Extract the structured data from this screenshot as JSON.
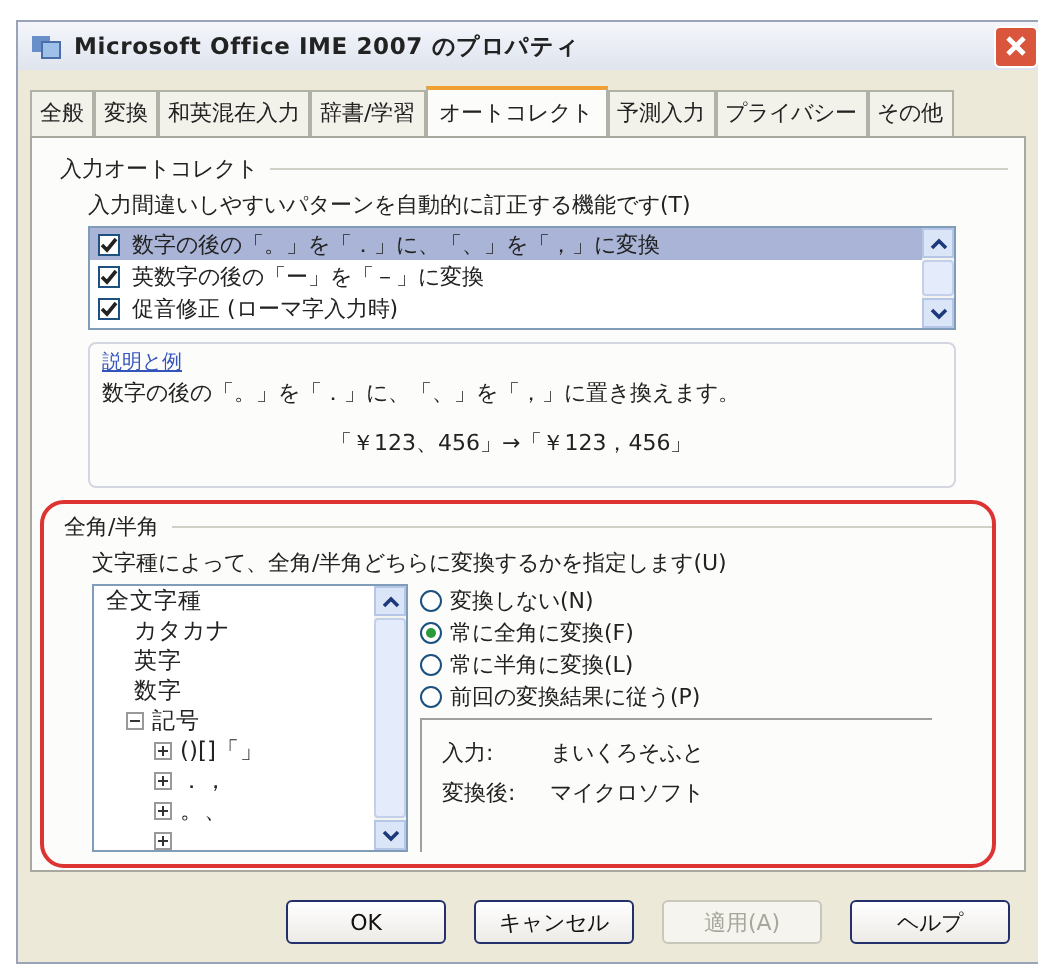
{
  "window": {
    "title": "Microsoft Office IME 2007 のプロパティ"
  },
  "tabs": [
    {
      "label": "全般",
      "selected": false
    },
    {
      "label": "変換",
      "selected": false
    },
    {
      "label": "和英混在入力",
      "selected": false
    },
    {
      "label": "辞書/学習",
      "selected": false
    },
    {
      "label": "オートコレクト",
      "selected": true
    },
    {
      "label": "予測入力",
      "selected": false
    },
    {
      "label": "プライバシー",
      "selected": false
    },
    {
      "label": "その他",
      "selected": false
    }
  ],
  "autocorrect": {
    "heading": "入力オートコレクト",
    "description": "入力間違いしやすいパターンを自動的に訂正する機能です(T)",
    "items": [
      {
        "label": "数字の後の「。」を「．」に、「、」を「，」に変換",
        "checked": true,
        "selected": true
      },
      {
        "label": "英数字の後の「ー」を「－」に変換",
        "checked": true,
        "selected": false
      },
      {
        "label": "促音修正 (ローマ字入力時)",
        "checked": true,
        "selected": false
      }
    ],
    "explanation": {
      "heading": "説明と例",
      "text": "数字の後の「。」を「．」に、「、」を「，」に置き換えます。",
      "example": "「￥123、456」→「￥123，456」"
    }
  },
  "width_section": {
    "heading": "全角/半角",
    "description": "文字種によって、全角/半角どちらに変換するかを指定します(U)",
    "tree": [
      {
        "label": "全文字種",
        "children": [
          {
            "label": "カタカナ"
          },
          {
            "label": "英字"
          },
          {
            "label": "数字"
          },
          {
            "label": "記号",
            "expanded": true,
            "children": [
              {
                "label": "()[]「」",
                "expanded": false
              },
              {
                "label": "．，",
                "expanded": false
              },
              {
                "label": "。、",
                "expanded": false
              },
              {
                "expanded": false
              }
            ]
          }
        ]
      }
    ],
    "options": [
      {
        "label": "変換しない(N)",
        "selected": false
      },
      {
        "label": "常に全角に変換(F)",
        "selected": true
      },
      {
        "label": "常に半角に変換(L)",
        "selected": false
      },
      {
        "label": "前回の変換結果に従う(P)",
        "selected": false
      }
    ],
    "preview": [
      {
        "label": "入力:",
        "value": "まいくろそふと"
      },
      {
        "label": "変換後:",
        "value": "マイクロソフト"
      }
    ]
  },
  "buttons": [
    {
      "label": "OK",
      "disabled": false
    },
    {
      "label": "キャンセル",
      "disabled": false
    },
    {
      "label": "適用(A)",
      "disabled": true
    },
    {
      "label": "ヘルプ",
      "disabled": false
    }
  ]
}
